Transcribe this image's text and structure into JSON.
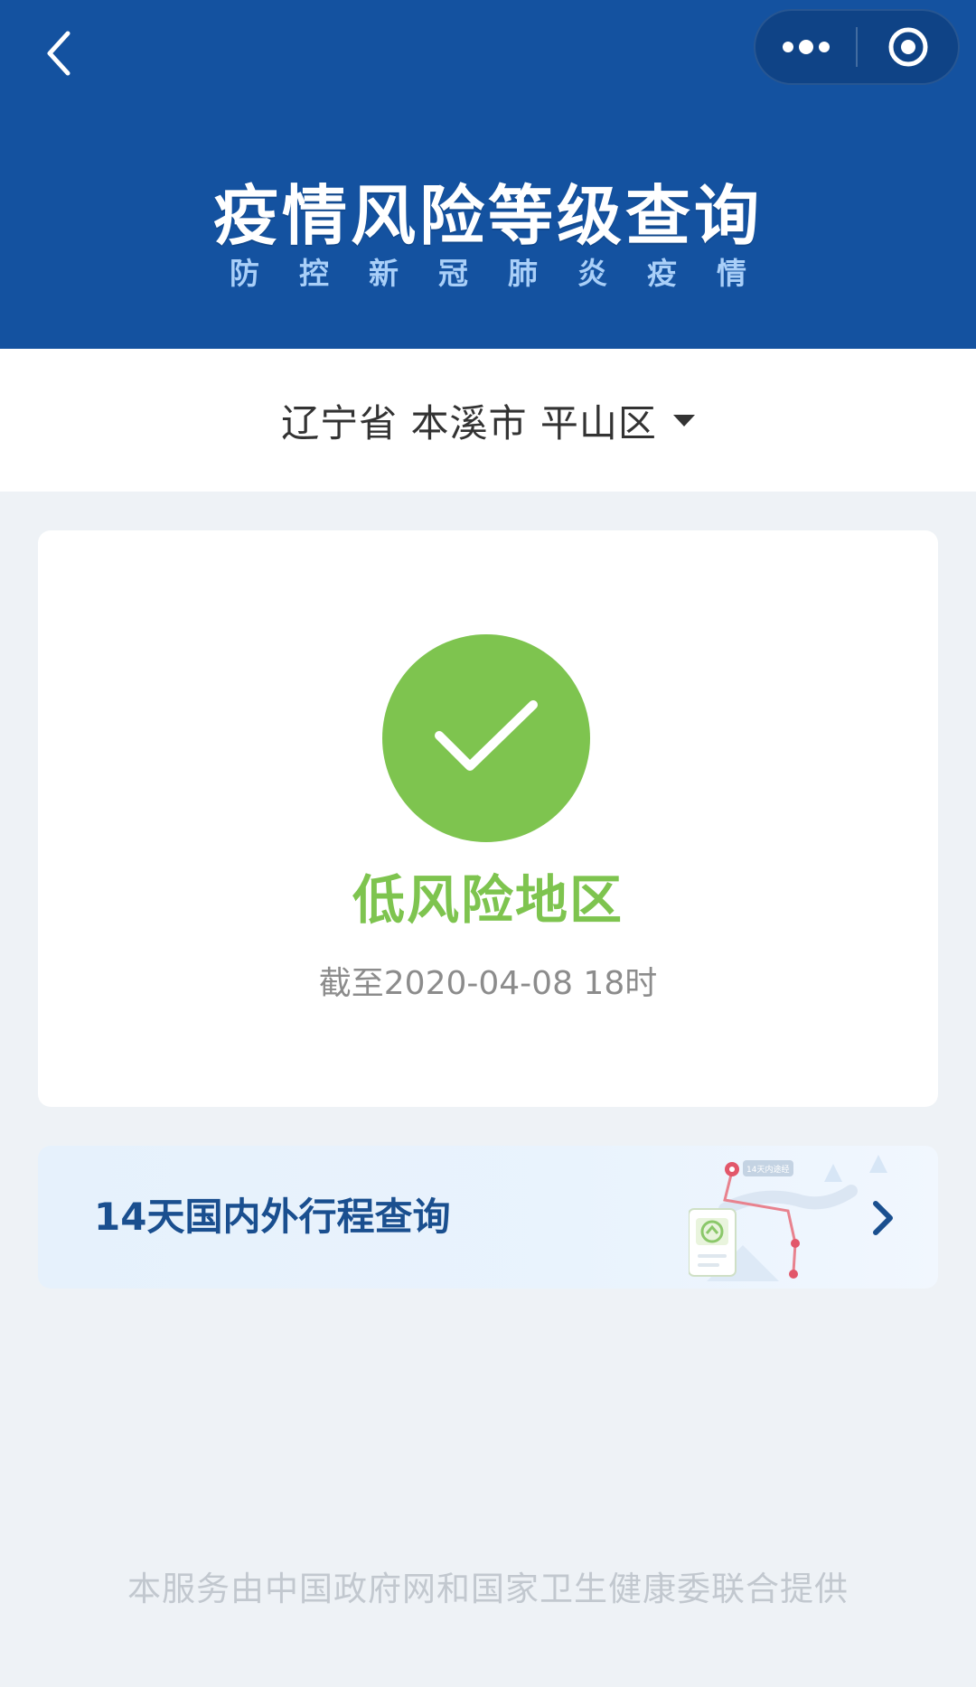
{
  "header": {
    "title": "疫情风险等级查询",
    "subtitle": "防控新冠肺炎疫情",
    "back_icon": "chevron-left-icon",
    "more_icon": "more-dots-icon",
    "target_icon": "target-icon",
    "color": "#1452a0"
  },
  "region": {
    "province": "辽宁省",
    "city": "本溪市",
    "district": "平山区",
    "label": "辽宁省 本溪市 平山区",
    "caret_icon": "caret-down-icon"
  },
  "risk": {
    "level": "低风险地区",
    "time": "截至2020-04-08 18时",
    "status_icon": "check-icon",
    "color": "#7ec44f"
  },
  "trip": {
    "label": "14天国内外行程查询",
    "map_tag": "14天内途经",
    "chevron_icon": "chevron-right-icon",
    "color": "#1a4f8f"
  },
  "footer": {
    "text": "本服务由中国政府网和国家卫生健康委联合提供"
  }
}
